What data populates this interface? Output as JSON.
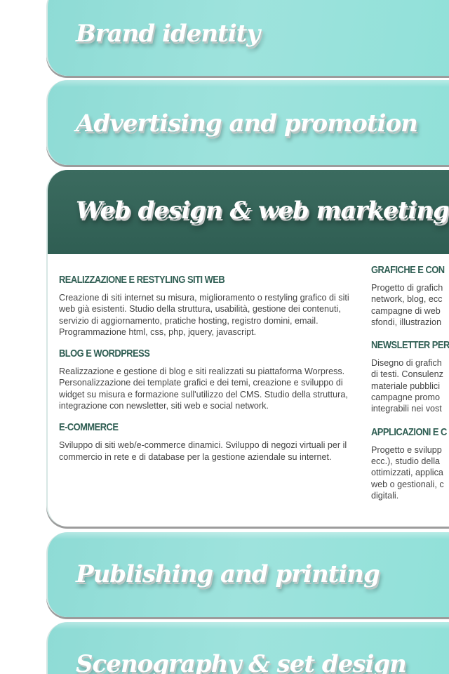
{
  "sections": [
    {
      "title": "Brand identity"
    },
    {
      "title": "Advertising and promotion"
    },
    {
      "title": "Web design & web marketing",
      "left_services": [
        {
          "heading": "REALIZZAZIONE E RESTYLING SITI WEB",
          "text": "Creazione di siti internet su misura, miglioramento o restyling grafico di siti web già esistenti. Studio della struttura, usabilità, gestione dei contenuti, servizio di aggiornamento, pratiche hosting, registro domini, email. Programmazione html, css, php, jquery, javascript."
        },
        {
          "heading": "BLOG E WORDPRESS",
          "text": "Realizzazione e gestione di blog e siti realizzati su piattaforma Worpress. Personalizzazione dei template grafici e dei temi, creazione e sviluppo di widget su misura e formazione sull'utilizzo del CMS. Studio della struttura, integrazione con newsletter, siti web e social network."
        },
        {
          "heading": "E-COMMERCE",
          "text": "Sviluppo di siti web/e-commerce dinamici. Sviluppo di negozi virtuali per il commercio in rete e di database per la gestione aziendale su internet."
        }
      ],
      "right_services": [
        {
          "heading": "GRAFICHE E CON",
          "text": "Progetto di grafich\nnetwork, blog, ecc\ncampagne di web\nsfondi, illustrazion"
        },
        {
          "heading": "NEWSLETTER PER",
          "text": "Disegno di grafich\ndi testi. Consulenz\nmateriale pubblici\ncampagne promo\nintegrabili nei vost"
        },
        {
          "heading": "APPLICAZIONI E C",
          "text": "Progetto e svilupp\necc.), studio della\nottimizzati, applica\nweb o gestionali, c\ndigitali."
        }
      ]
    },
    {
      "title": "Publishing and printing"
    },
    {
      "title": "Scenography & set design"
    }
  ]
}
